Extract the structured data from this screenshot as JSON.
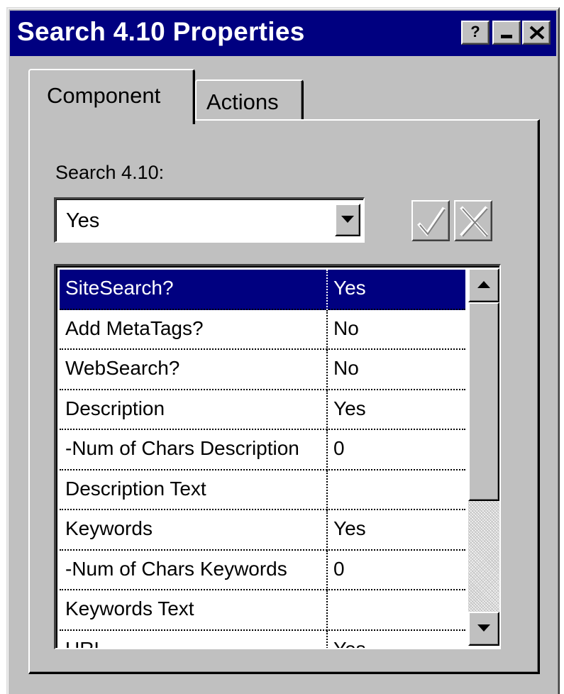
{
  "window": {
    "title": "Search 4.10 Properties",
    "titlebar_color": "#000080",
    "buttons": {
      "help_label": "?",
      "minimize": "minimize-icon",
      "close": "close-icon"
    }
  },
  "tabs": [
    {
      "label": "Component",
      "active": true
    },
    {
      "label": "Actions",
      "active": false
    }
  ],
  "component": {
    "field_label": "Search 4.10:",
    "combo_value": "Yes",
    "ok_icon": "checkmark-icon",
    "cancel_icon": "cross-icon"
  },
  "grid": {
    "selection_color": "#000080",
    "rows": [
      {
        "name": "SiteSearch?",
        "value": "Yes",
        "selected": true
      },
      {
        "name": "Add MetaTags?",
        "value": "No"
      },
      {
        "name": "WebSearch?",
        "value": "No"
      },
      {
        "name": "Description",
        "value": "Yes"
      },
      {
        "name": "-Num of Chars Description",
        "value": "0"
      },
      {
        "name": "Description Text",
        "value": ""
      },
      {
        "name": "Keywords",
        "value": "Yes"
      },
      {
        "name": "-Num of Chars Keywords",
        "value": "0"
      },
      {
        "name": "Keywords Text",
        "value": ""
      },
      {
        "name": "URL",
        "value": "Yes"
      }
    ]
  }
}
